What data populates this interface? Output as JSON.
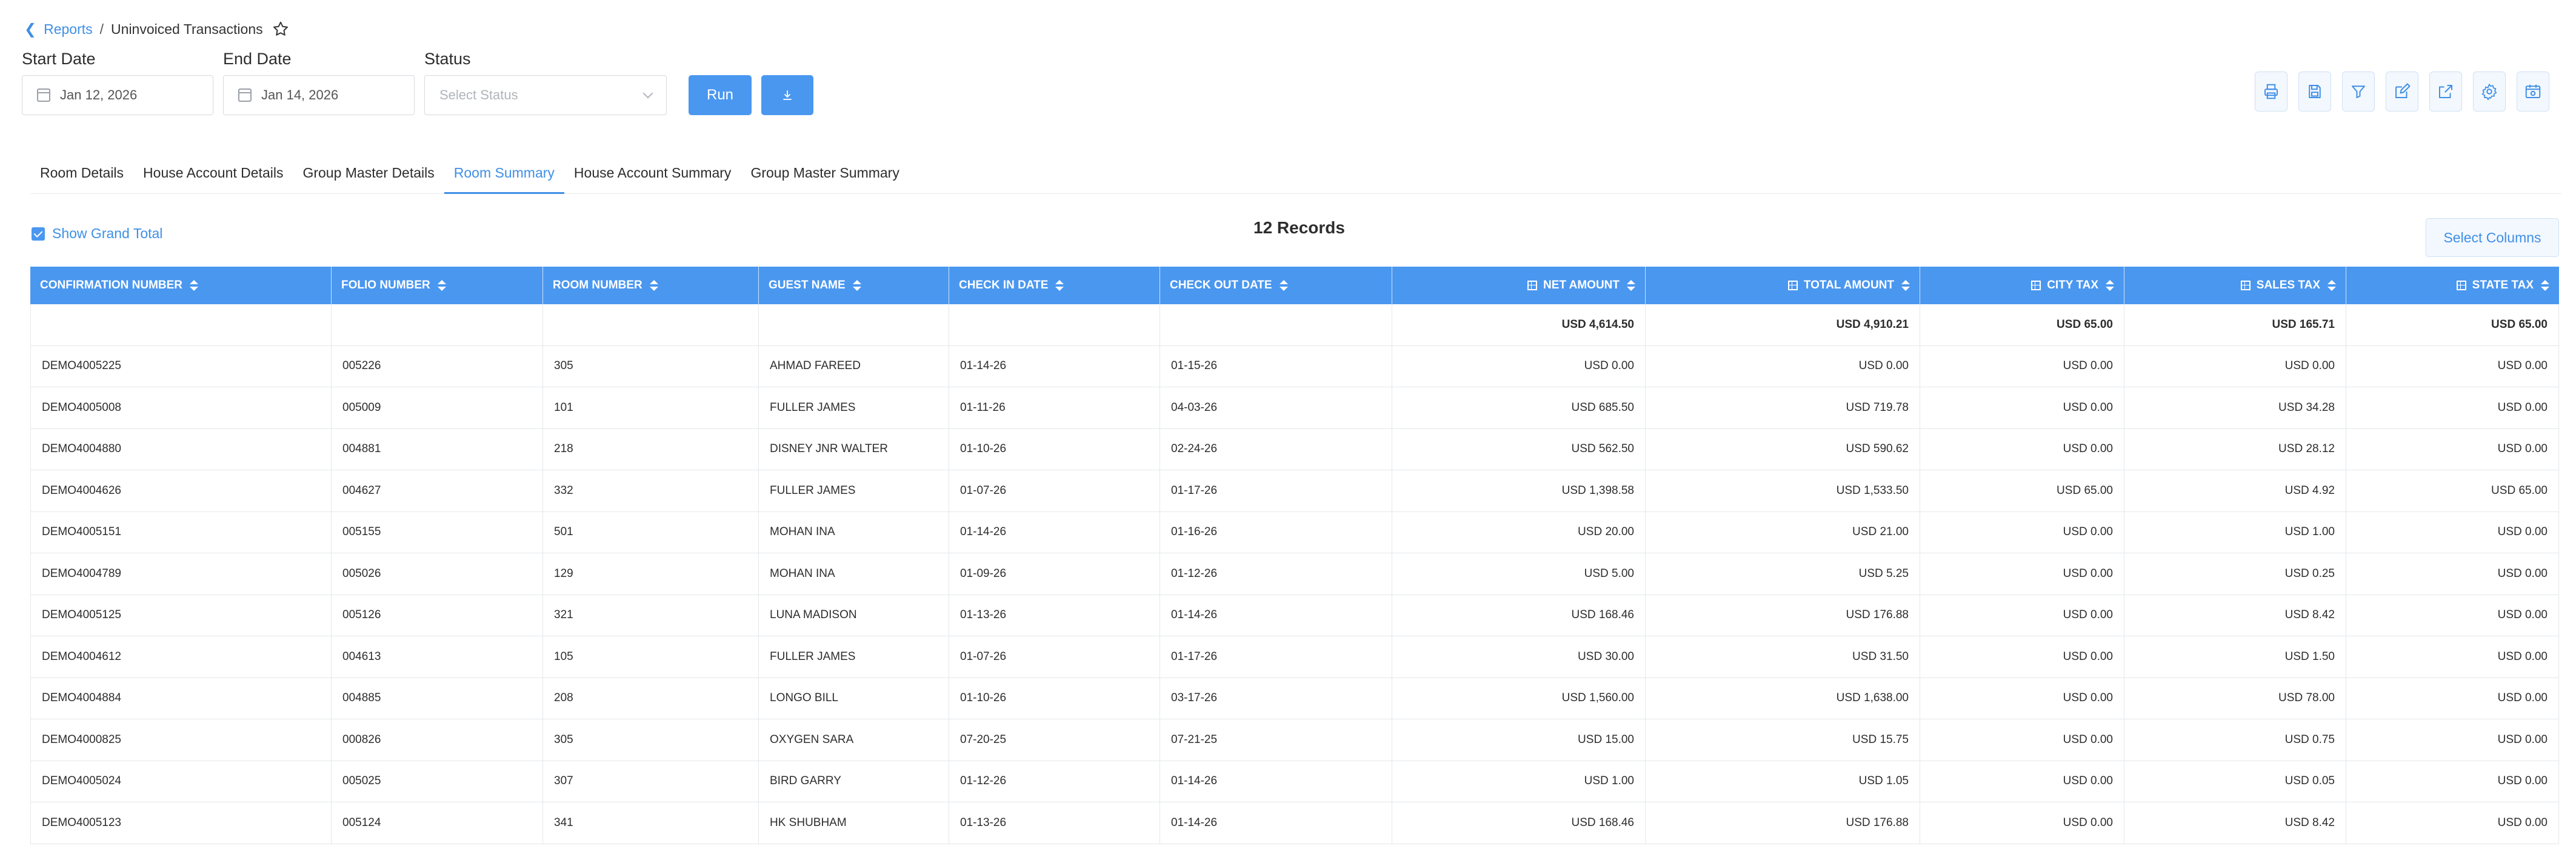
{
  "breadcrumb": {
    "parent": "Reports",
    "separator": "/",
    "current": "Uninvoiced Transactions"
  },
  "filters": {
    "start_date_label": "Start Date",
    "start_date_value": "Jan 12, 2026",
    "end_date_label": "End Date",
    "end_date_value": "Jan 14, 2026",
    "status_label": "Status",
    "status_placeholder": "Select Status",
    "run_label": "Run"
  },
  "tabs": [
    {
      "label": "Room Details",
      "active": false
    },
    {
      "label": "House Account Details",
      "active": false
    },
    {
      "label": "Group Master Details",
      "active": false
    },
    {
      "label": "Room Summary",
      "active": true
    },
    {
      "label": "House Account Summary",
      "active": false
    },
    {
      "label": "Group Master Summary",
      "active": false
    }
  ],
  "show_grand_total_label": "Show Grand Total",
  "records_label": "12 Records",
  "select_columns_label": "Select Columns",
  "colors": {
    "accent": "#4a97f0",
    "link": "#3f8fe6"
  },
  "table": {
    "columns": [
      "CONFIRMATION NUMBER",
      "FOLIO NUMBER",
      "ROOM NUMBER",
      "GUEST NAME",
      "CHECK IN DATE",
      "CHECK OUT DATE",
      "NET AMOUNT",
      "TOTAL AMOUNT",
      "CITY TAX",
      "SALES TAX",
      "STATE TAX"
    ],
    "totals": [
      "",
      "",
      "",
      "",
      "",
      "",
      "USD 4,614.50",
      "USD 4,910.21",
      "USD 65.00",
      "USD 165.71",
      "USD 65.00"
    ],
    "rows": [
      [
        "DEMO4005225",
        "005226",
        "305",
        "AHMAD FAREED",
        "01-14-26",
        "01-15-26",
        "USD 0.00",
        "USD 0.00",
        "USD 0.00",
        "USD 0.00",
        "USD 0.00"
      ],
      [
        "DEMO4005008",
        "005009",
        "101",
        "FULLER JAMES",
        "01-11-26",
        "04-03-26",
        "USD 685.50",
        "USD 719.78",
        "USD 0.00",
        "USD 34.28",
        "USD 0.00"
      ],
      [
        "DEMO4004880",
        "004881",
        "218",
        "DISNEY JNR WALTER",
        "01-10-26",
        "02-24-26",
        "USD 562.50",
        "USD 590.62",
        "USD 0.00",
        "USD 28.12",
        "USD 0.00"
      ],
      [
        "DEMO4004626",
        "004627",
        "332",
        "FULLER JAMES",
        "01-07-26",
        "01-17-26",
        "USD 1,398.58",
        "USD 1,533.50",
        "USD 65.00",
        "USD 4.92",
        "USD 65.00"
      ],
      [
        "DEMO4005151",
        "005155",
        "501",
        "MOHAN INA",
        "01-14-26",
        "01-16-26",
        "USD 20.00",
        "USD 21.00",
        "USD 0.00",
        "USD 1.00",
        "USD 0.00"
      ],
      [
        "DEMO4004789",
        "005026",
        "129",
        "MOHAN INA",
        "01-09-26",
        "01-12-26",
        "USD 5.00",
        "USD 5.25",
        "USD 0.00",
        "USD 0.25",
        "USD 0.00"
      ],
      [
        "DEMO4005125",
        "005126",
        "321",
        "LUNA MADISON",
        "01-13-26",
        "01-14-26",
        "USD 168.46",
        "USD 176.88",
        "USD 0.00",
        "USD 8.42",
        "USD 0.00"
      ],
      [
        "DEMO4004612",
        "004613",
        "105",
        "FULLER JAMES",
        "01-07-26",
        "01-17-26",
        "USD 30.00",
        "USD 31.50",
        "USD 0.00",
        "USD 1.50",
        "USD 0.00"
      ],
      [
        "DEMO4004884",
        "004885",
        "208",
        "LONGO BILL",
        "01-10-26",
        "03-17-26",
        "USD 1,560.00",
        "USD 1,638.00",
        "USD 0.00",
        "USD 78.00",
        "USD 0.00"
      ],
      [
        "DEMO4000825",
        "000826",
        "305",
        "OXYGEN SARA",
        "07-20-25",
        "07-21-25",
        "USD 15.00",
        "USD 15.75",
        "USD 0.00",
        "USD 0.75",
        "USD 0.00"
      ],
      [
        "DEMO4005024",
        "005025",
        "307",
        "BIRD GARRY",
        "01-12-26",
        "01-14-26",
        "USD 1.00",
        "USD 1.05",
        "USD 0.00",
        "USD 0.05",
        "USD 0.00"
      ],
      [
        "DEMO4005123",
        "005124",
        "341",
        "HK SHUBHAM",
        "01-13-26",
        "01-14-26",
        "USD 168.46",
        "USD 176.88",
        "USD 0.00",
        "USD 8.42",
        "USD 0.00"
      ]
    ]
  }
}
